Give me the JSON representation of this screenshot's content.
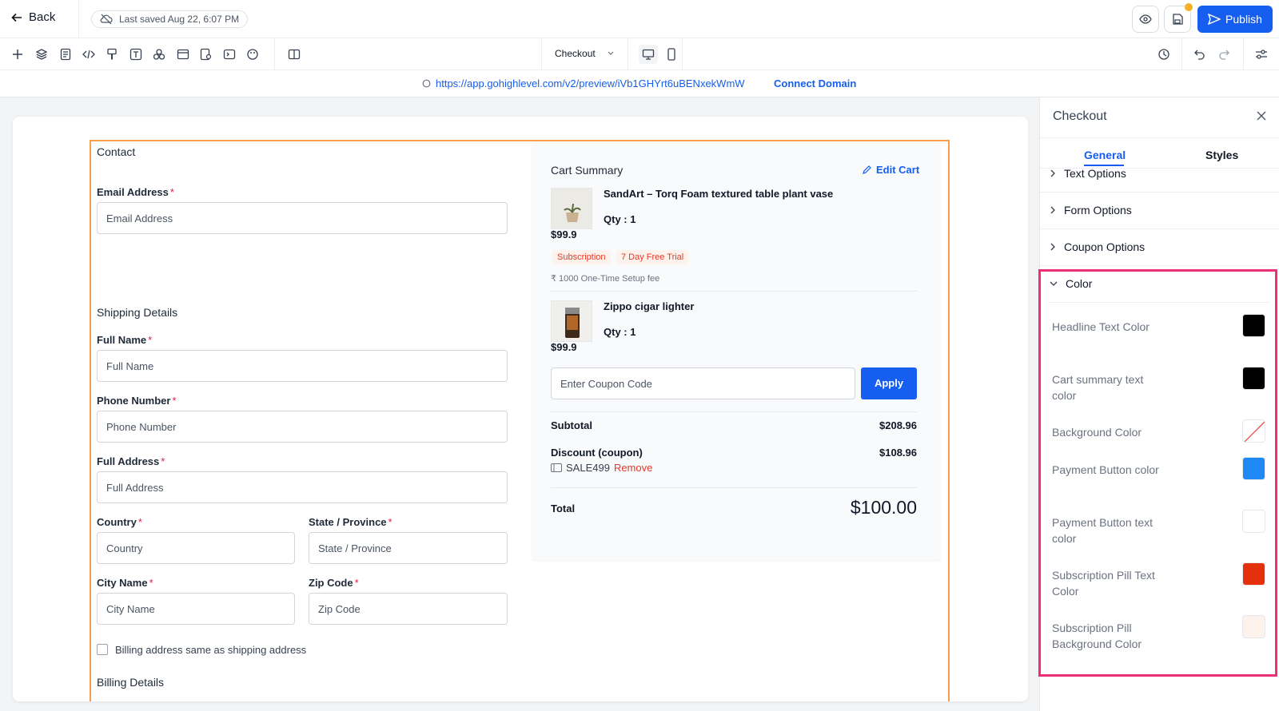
{
  "topbar": {
    "back_label": "Back",
    "saved_text": "Last saved Aug 22, 6:07 PM",
    "publish_label": "Publish"
  },
  "toolbar": {
    "page_selector": "Checkout"
  },
  "urlbar": {
    "url": "https://app.gohighlevel.com/v2/preview/iVb1GHYrt6uBENxekWmW",
    "connect_label": "Connect Domain"
  },
  "form": {
    "contact_title": "Contact",
    "email_label": "Email Address",
    "email_placeholder": "Email Address",
    "shipping_title": "Shipping Details",
    "fullname_label": "Full Name",
    "fullname_placeholder": "Full Name",
    "phone_label": "Phone Number",
    "phone_placeholder": "Phone Number",
    "address_label": "Full Address",
    "address_placeholder": "Full Address",
    "country_label": "Country",
    "country_placeholder": "Country",
    "state_label": "State / Province",
    "state_placeholder": "State / Province",
    "city_label": "City Name",
    "city_placeholder": "City Name",
    "zip_label": "Zip Code",
    "zip_placeholder": "Zip Code",
    "billing_same_label": "Billing address same as shipping address",
    "billing_title": "Billing Details",
    "required_mark": "*"
  },
  "cart": {
    "title": "Cart Summary",
    "edit_label": "Edit Cart",
    "items": [
      {
        "name": "SandArt – Torq Foam textured table plant vase",
        "qty": "Qty : 1",
        "price": "$99.9",
        "pill1": "Subscription",
        "pill2": "7 Day Free Trial",
        "setup_fee": "₹ 1000 One-Time Setup fee"
      },
      {
        "name": "Zippo cigar lighter",
        "qty": "Qty : 1",
        "price": "$99.9"
      }
    ],
    "coupon_placeholder": "Enter Coupon Code",
    "apply_label": "Apply",
    "subtotal_label": "Subtotal",
    "subtotal_value": "$208.96",
    "discount_label": "Discount (coupon)",
    "discount_value": "$108.96",
    "coupon_code": "SALE499",
    "remove_label": "Remove",
    "total_label": "Total",
    "total_value": "$100.00"
  },
  "panel": {
    "title": "Checkout",
    "tabs": [
      "General",
      "Styles"
    ],
    "accordions": [
      "Text Options",
      "Form Options",
      "Coupon Options",
      "Color"
    ],
    "colors": [
      {
        "label": "Headline Text Color",
        "value": "#000000"
      },
      {
        "label": "Cart summary text color",
        "value": "#000000"
      },
      {
        "label": "Background Color",
        "value": "transparent"
      },
      {
        "label": "Payment Button color",
        "value": "#1e88f5"
      },
      {
        "label": "Payment Button text color",
        "value": "#ffffff"
      },
      {
        "label": "Subscription Pill Text Color",
        "value": "#e5300c"
      },
      {
        "label": "Subscription Pill Background Color",
        "value": "#fdf2ec"
      }
    ]
  }
}
